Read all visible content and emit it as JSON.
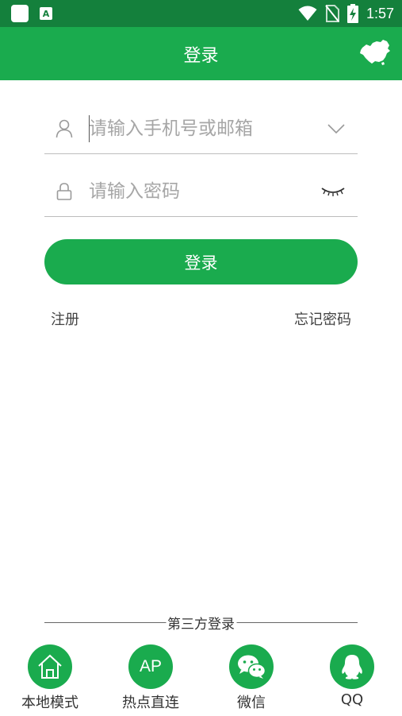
{
  "status_bar": {
    "time": "1:57",
    "notification_icon_letter": "A",
    "icons": [
      "app-notification-icon",
      "text-notification-icon",
      "wifi-icon",
      "no-sim-icon",
      "battery-charging-icon"
    ]
  },
  "header": {
    "title": "登录",
    "right_icon": "china-map-icon"
  },
  "form": {
    "username_placeholder": "请输入手机号或邮箱",
    "password_placeholder": "请输入密码",
    "login_button": "登录",
    "register_link": "注册",
    "forgot_link": "忘记密码"
  },
  "third_party": {
    "title": "第三方登录",
    "items": [
      {
        "label": "本地模式",
        "icon": "home-icon"
      },
      {
        "label": "热点直连",
        "icon": "ap-icon",
        "icon_text": "AP"
      },
      {
        "label": "微信",
        "icon": "wechat-icon"
      },
      {
        "label": "QQ",
        "icon": "qq-icon"
      }
    ]
  },
  "colors": {
    "status_bar": "#14803c",
    "primary": "#1aab4e",
    "placeholder": "#a6a6a6"
  }
}
